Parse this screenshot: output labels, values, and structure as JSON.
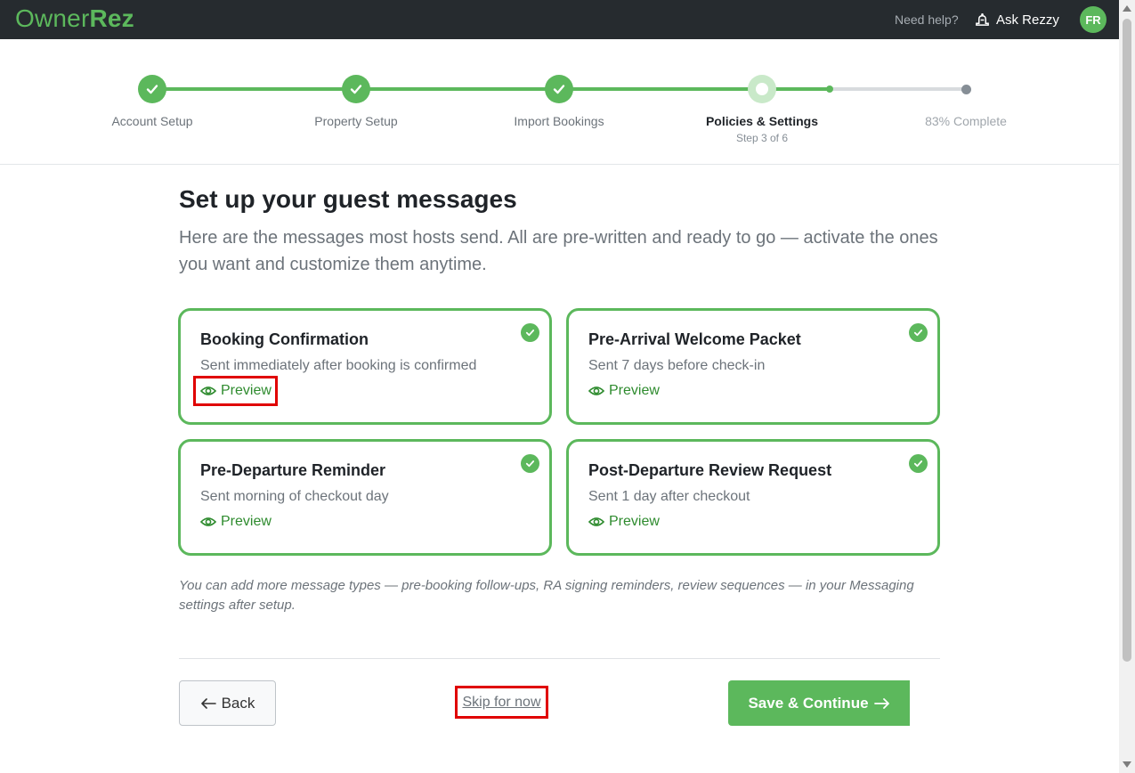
{
  "header": {
    "logo_owner": "Owner",
    "logo_rez": "Rez",
    "help_text": "Need help?",
    "ask_label": "Ask Rezzy",
    "avatar_initials": "FR"
  },
  "stepper": {
    "steps": [
      {
        "label": "Account Setup",
        "state": "done"
      },
      {
        "label": "Property Setup",
        "state": "done"
      },
      {
        "label": "Import Bookings",
        "state": "done"
      },
      {
        "label": "Policies & Settings",
        "state": "current",
        "sub": "Step 3 of 6"
      }
    ],
    "complete_text": "83% Complete",
    "progress_percent": 83
  },
  "main": {
    "title": "Set up your guest messages",
    "subtitle": "Here are the messages most hosts send. All are pre-written and ready to go — activate the ones you want and customize them anytime.",
    "preview_label": "Preview",
    "cards": [
      {
        "title": "Booking Confirmation",
        "desc": "Sent immediately after booking is confirmed",
        "checked": true
      },
      {
        "title": "Pre-Arrival Welcome Packet",
        "desc": "Sent 7 days before check-in",
        "checked": true
      },
      {
        "title": "Pre-Departure Reminder",
        "desc": "Sent morning of checkout day",
        "checked": true
      },
      {
        "title": "Post-Departure Review Request",
        "desc": "Sent 1 day after checkout",
        "checked": true
      }
    ],
    "note": "You can add more message types — pre-booking follow-ups, RA signing reminders, review sequences — in your Messaging settings after setup."
  },
  "footer": {
    "back_label": "Back",
    "skip_label": "Skip for now",
    "save_label": "Save & Continue"
  },
  "colors": {
    "brand_green": "#5cb85c",
    "header_bg": "#262b2f",
    "highlight_red": "#e00000"
  }
}
